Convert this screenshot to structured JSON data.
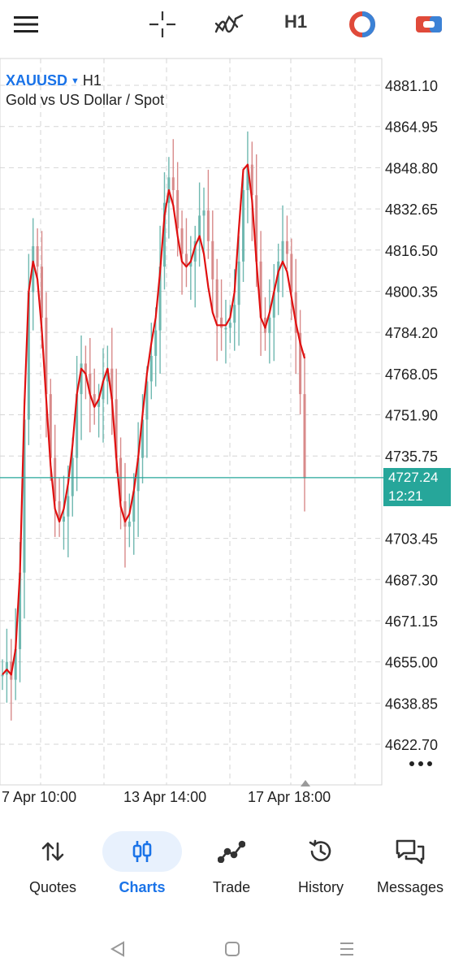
{
  "toolbar": {
    "menu_icon": "hamburger-menu-icon",
    "crosshair_icon": "crosshair-icon",
    "indicators_icon": "indicators-icon",
    "timeframe": "H1",
    "chart_type_icon": "chart-type-icon",
    "trade_icon": "trade-icon"
  },
  "chart": {
    "symbol": "XAUUSD",
    "timeframe": "H1",
    "description": "Gold vs US Dollar / Spot",
    "current_price": "4727.24",
    "countdown": "12:21",
    "colors": {
      "grid": "#d6d6d6",
      "bull": "#6fb8b0",
      "bear": "#d88a8a",
      "ma": "#e01010",
      "price_line": "#26a69a",
      "price_tag": "#26a69a"
    }
  },
  "chart_data": {
    "type": "line",
    "title": "",
    "price_axis_labels": [
      "4881.10",
      "4864.95",
      "4848.80",
      "4832.65",
      "4816.50",
      "4800.35",
      "4784.20",
      "4768.05",
      "4751.90",
      "4735.75",
      "4703.45",
      "4687.30",
      "4671.15",
      "4655.00",
      "4638.85",
      "4622.70"
    ],
    "time_axis_labels": [
      "7 Apr 10:00",
      "13 Apr 14:00",
      "17 Apr 18:00"
    ],
    "ylim": [
      4615,
      4910
    ],
    "grid": true,
    "series": [
      {
        "type": "candlestick_sketch",
        "values": [
          4650,
          4655,
          4648,
          4660,
          4690,
          4750,
          4800,
          4818,
          4810,
          4790,
          4760,
          4735,
          4718,
          4710,
          4712,
          4720,
          4735,
          4760,
          4772,
          4768,
          4760,
          4755,
          4758,
          4765,
          4770,
          4758,
          4735,
          4718,
          4708,
          4710,
          4722,
          4735,
          4750,
          4765,
          4775,
          4785,
          4810,
          4835,
          4845,
          4840,
          4825,
          4815,
          4810,
          4812,
          4820,
          4830,
          4832,
          4820,
          4805,
          4790,
          4786,
          4786,
          4788,
          4795,
          4812,
          4840,
          4850,
          4838,
          4812,
          4790,
          4784,
          4790,
          4800,
          4812,
          4820,
          4815,
          4800,
          4784,
          4760,
          4727
        ]
      },
      {
        "type": "moving_average",
        "values": [
          4650,
          4652,
          4650,
          4660,
          4690,
          4755,
          4800,
          4812,
          4805,
          4785,
          4758,
          4732,
          4715,
          4710,
          4715,
          4725,
          4740,
          4760,
          4770,
          4768,
          4760,
          4755,
          4758,
          4765,
          4770,
          4758,
          4735,
          4716,
          4710,
          4713,
          4722,
          4735,
          4752,
          4768,
          4780,
          4790,
          4808,
          4830,
          4840,
          4834,
          4822,
          4812,
          4810,
          4812,
          4818,
          4822,
          4815,
          4802,
          4792,
          4787,
          4787,
          4787,
          4790,
          4800,
          4825,
          4848,
          4850,
          4836,
          4812,
          4790,
          4786,
          4792,
          4800,
          4808,
          4812,
          4808,
          4798,
          4788,
          4780,
          4774
        ]
      }
    ]
  },
  "bottom_nav": [
    {
      "label": "Quotes",
      "icon": "quotes-arrows-icon"
    },
    {
      "label": "Charts",
      "icon": "charts-candles-icon",
      "active": true
    },
    {
      "label": "Trade",
      "icon": "trade-line-icon"
    },
    {
      "label": "History",
      "icon": "history-clock-icon"
    },
    {
      "label": "Messages",
      "icon": "messages-chat-icon"
    }
  ],
  "system_nav": {
    "back_icon": "back-triangle-icon",
    "home_icon": "home-square-icon",
    "recents_icon": "recents-lines-icon"
  }
}
